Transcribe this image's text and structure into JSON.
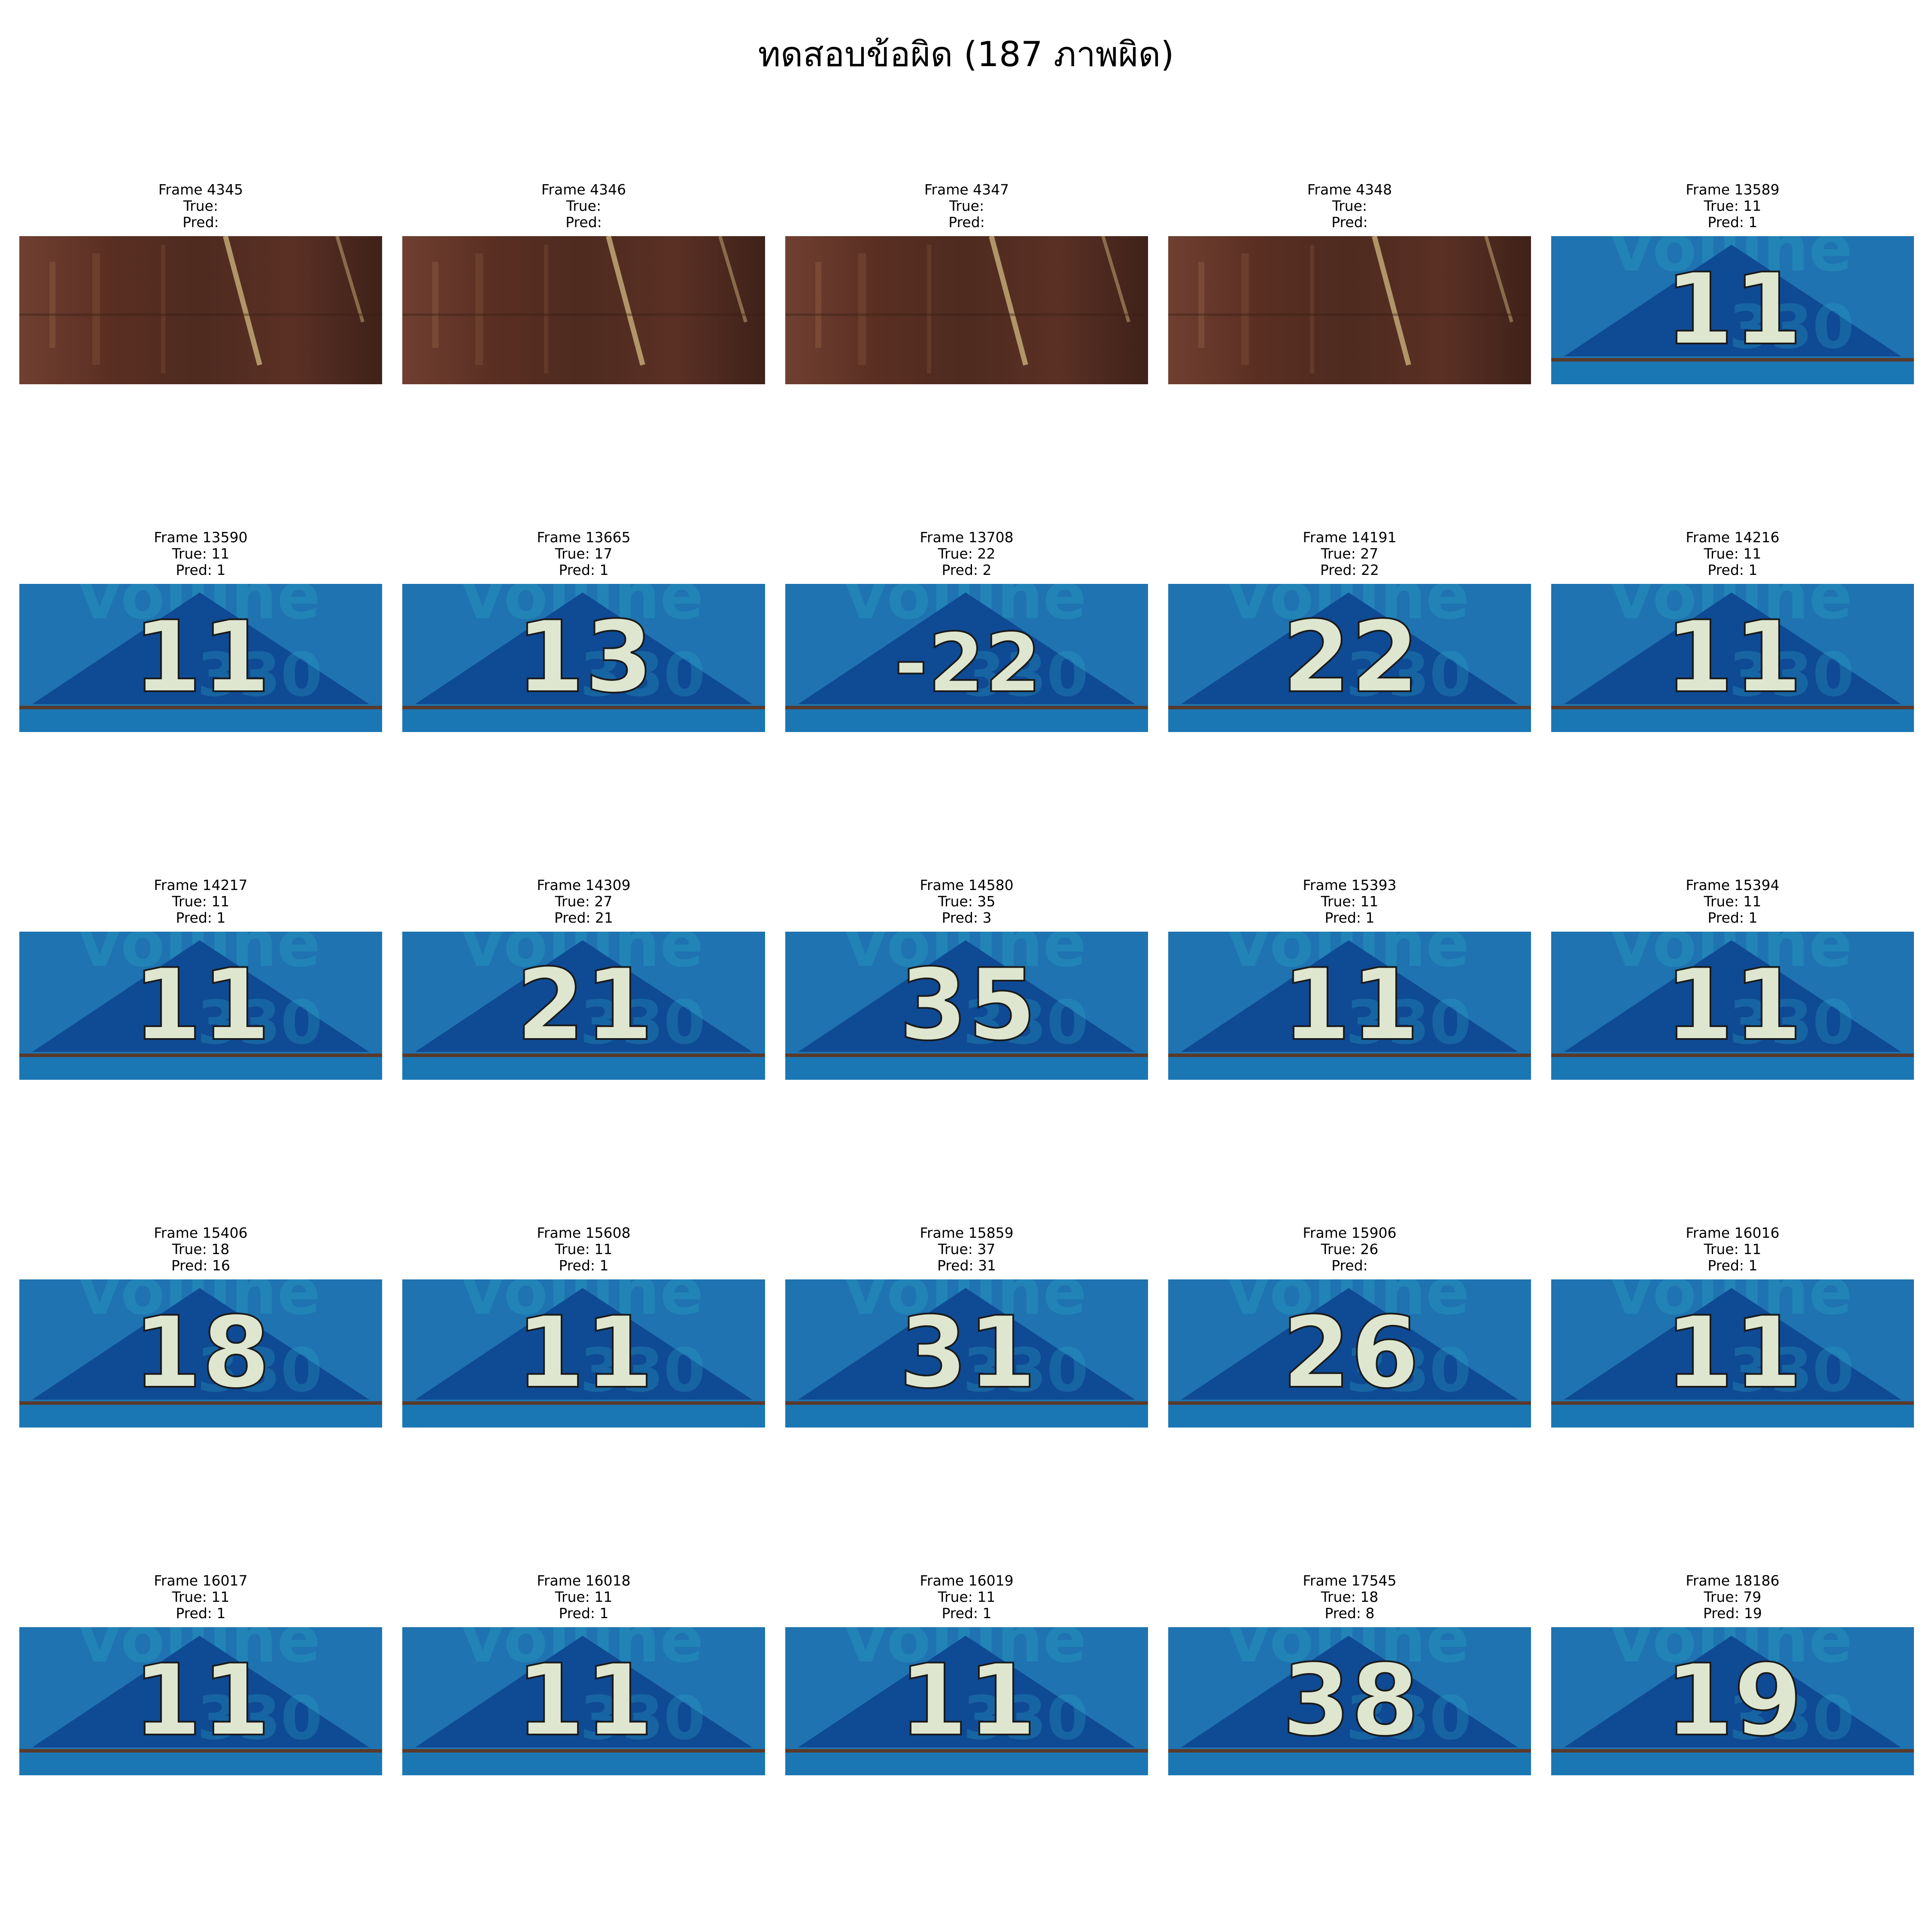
{
  "title": "ทดสอบข้อผิด (187 ภาพผิด)",
  "colors": {
    "wood_base": "#5a2f22",
    "sign_blue": "#1f73b0",
    "sign_triangle": "#0f4a94",
    "digit": "#dfe6cf"
  },
  "samples": [
    {
      "frame": "Frame 4345",
      "true": "True:",
      "pred": "Pred:",
      "kind": "wood",
      "digits": ""
    },
    {
      "frame": "Frame 4346",
      "true": "True:",
      "pred": "Pred:",
      "kind": "wood",
      "digits": ""
    },
    {
      "frame": "Frame 4347",
      "true": "True:",
      "pred": "Pred:",
      "kind": "wood",
      "digits": ""
    },
    {
      "frame": "Frame 4348",
      "true": "True:",
      "pred": "Pred:",
      "kind": "wood",
      "digits": ""
    },
    {
      "frame": "Frame 13589",
      "true": "True: 11",
      "pred": "Pred: 1",
      "kind": "sign",
      "digits": "11"
    },
    {
      "frame": "Frame 13590",
      "true": "True: 11",
      "pred": "Pred: 1",
      "kind": "sign",
      "digits": "11"
    },
    {
      "frame": "Frame 13665",
      "true": "True: 17",
      "pred": "Pred: 1",
      "kind": "sign",
      "digits": "13"
    },
    {
      "frame": "Frame 13708",
      "true": "True: 22",
      "pred": "Pred: 2",
      "kind": "sign",
      "digits": "-22"
    },
    {
      "frame": "Frame 14191",
      "true": "True: 27",
      "pred": "Pred: 22",
      "kind": "sign",
      "digits": "22"
    },
    {
      "frame": "Frame 14216",
      "true": "True: 11",
      "pred": "Pred: 1",
      "kind": "sign",
      "digits": "11"
    },
    {
      "frame": "Frame 14217",
      "true": "True: 11",
      "pred": "Pred: 1",
      "kind": "sign",
      "digits": "11"
    },
    {
      "frame": "Frame 14309",
      "true": "True: 27",
      "pred": "Pred: 21",
      "kind": "sign",
      "digits": "21"
    },
    {
      "frame": "Frame 14580",
      "true": "True: 35",
      "pred": "Pred: 3",
      "kind": "sign",
      "digits": "35"
    },
    {
      "frame": "Frame 15393",
      "true": "True: 11",
      "pred": "Pred: 1",
      "kind": "sign",
      "digits": "11"
    },
    {
      "frame": "Frame 15394",
      "true": "True: 11",
      "pred": "Pred: 1",
      "kind": "sign",
      "digits": "11"
    },
    {
      "frame": "Frame 15406",
      "true": "True: 18",
      "pred": "Pred: 16",
      "kind": "sign",
      "digits": "18"
    },
    {
      "frame": "Frame 15608",
      "true": "True: 11",
      "pred": "Pred: 1",
      "kind": "sign",
      "digits": "11"
    },
    {
      "frame": "Frame 15859",
      "true": "True: 37",
      "pred": "Pred: 31",
      "kind": "sign",
      "digits": "31"
    },
    {
      "frame": "Frame 15906",
      "true": "True: 26",
      "pred": "Pred:",
      "kind": "sign",
      "digits": "26"
    },
    {
      "frame": "Frame 16016",
      "true": "True: 11",
      "pred": "Pred: 1",
      "kind": "sign",
      "digits": "11"
    },
    {
      "frame": "Frame 16017",
      "true": "True: 11",
      "pred": "Pred: 1",
      "kind": "sign",
      "digits": "11"
    },
    {
      "frame": "Frame 16018",
      "true": "True: 11",
      "pred": "Pred: 1",
      "kind": "sign",
      "digits": "11"
    },
    {
      "frame": "Frame 16019",
      "true": "True: 11",
      "pred": "Pred: 1",
      "kind": "sign",
      "digits": "11"
    },
    {
      "frame": "Frame 17545",
      "true": "True: 18",
      "pred": "Pred: 8",
      "kind": "sign",
      "digits": "38"
    },
    {
      "frame": "Frame 18186",
      "true": "True: 79",
      "pred": "Pred: 19",
      "kind": "sign",
      "digits": "19"
    }
  ]
}
